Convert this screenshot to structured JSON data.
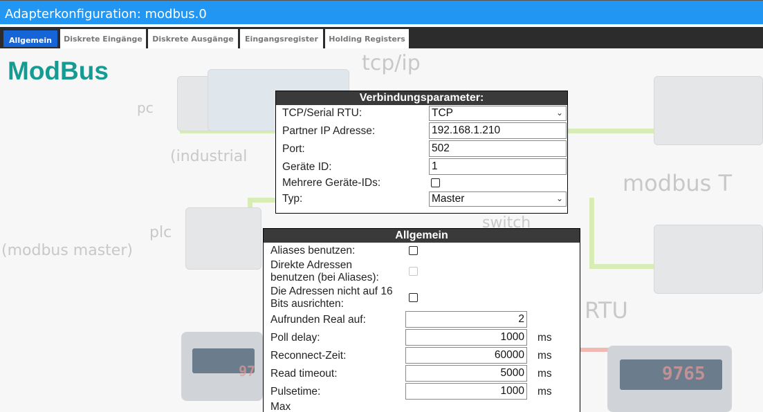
{
  "window": {
    "title": "Adapterkonfiguration: modbus.0"
  },
  "tabs": [
    {
      "label": "Allgemein",
      "active": true
    },
    {
      "label": "Diskrete Eingänge",
      "active": false
    },
    {
      "label": "Diskrete Ausgänge",
      "active": false
    },
    {
      "label": "Eingangsregister",
      "active": false
    },
    {
      "label": "Holding Registers",
      "active": false
    }
  ],
  "page": {
    "heading": "ModBus"
  },
  "background": {
    "labels": {
      "tcpip": "tcp/ip",
      "pc": "pc",
      "industrial": "(industrial",
      "modbus": "modbus T",
      "plc": "plc",
      "plc_sub": "(modbus master)",
      "switch": "switch",
      "rtu": "RTU",
      "digits_left": "97",
      "digits_right": "9765"
    }
  },
  "connection": {
    "header": "Verbindungsparameter:",
    "tcp_serial_label": "TCP/Serial RTU:",
    "tcp_serial_value": "TCP",
    "partner_ip_label": "Partner IP Adresse:",
    "partner_ip_value": "192.168.1.210",
    "port_label": "Port:",
    "port_value": "502",
    "device_id_label": "Geräte ID:",
    "device_id_value": "1",
    "multi_ids_label": "Mehrere Geräte-IDs:",
    "multi_ids_checked": false,
    "type_label": "Typ:",
    "type_value": "Master"
  },
  "general": {
    "header": "Allgemein",
    "aliases_label": "Aliases benutzen:",
    "aliases_checked": false,
    "direct_addr_label_1": "Direkte Adressen",
    "direct_addr_label_2": "benutzen (bei Aliases):",
    "direct_addr_checked": false,
    "align_label_1": "Die Adressen nicht auf 16",
    "align_label_2": "Bits ausrichten:",
    "align_checked": false,
    "round_label": "Aufrunden Real auf:",
    "round_value": "2",
    "poll_label": "Poll delay:",
    "poll_value": "1000",
    "poll_unit": "ms",
    "reconnect_label": "Reconnect-Zeit:",
    "reconnect_value": "60000",
    "reconnect_unit": "ms",
    "read_timeout_label": "Read timeout:",
    "read_timeout_value": "5000",
    "read_timeout_unit": "ms",
    "pulsetime_label": "Pulsetime:",
    "pulsetime_value": "1000",
    "pulsetime_unit": "ms",
    "max_label": "Max"
  },
  "colors": {
    "titlebar": "#2196F3",
    "tab_active": "#1565d8",
    "tabbar": "#2c2c2c",
    "heading": "#169b93",
    "panel_header": "#3a3a3a"
  }
}
